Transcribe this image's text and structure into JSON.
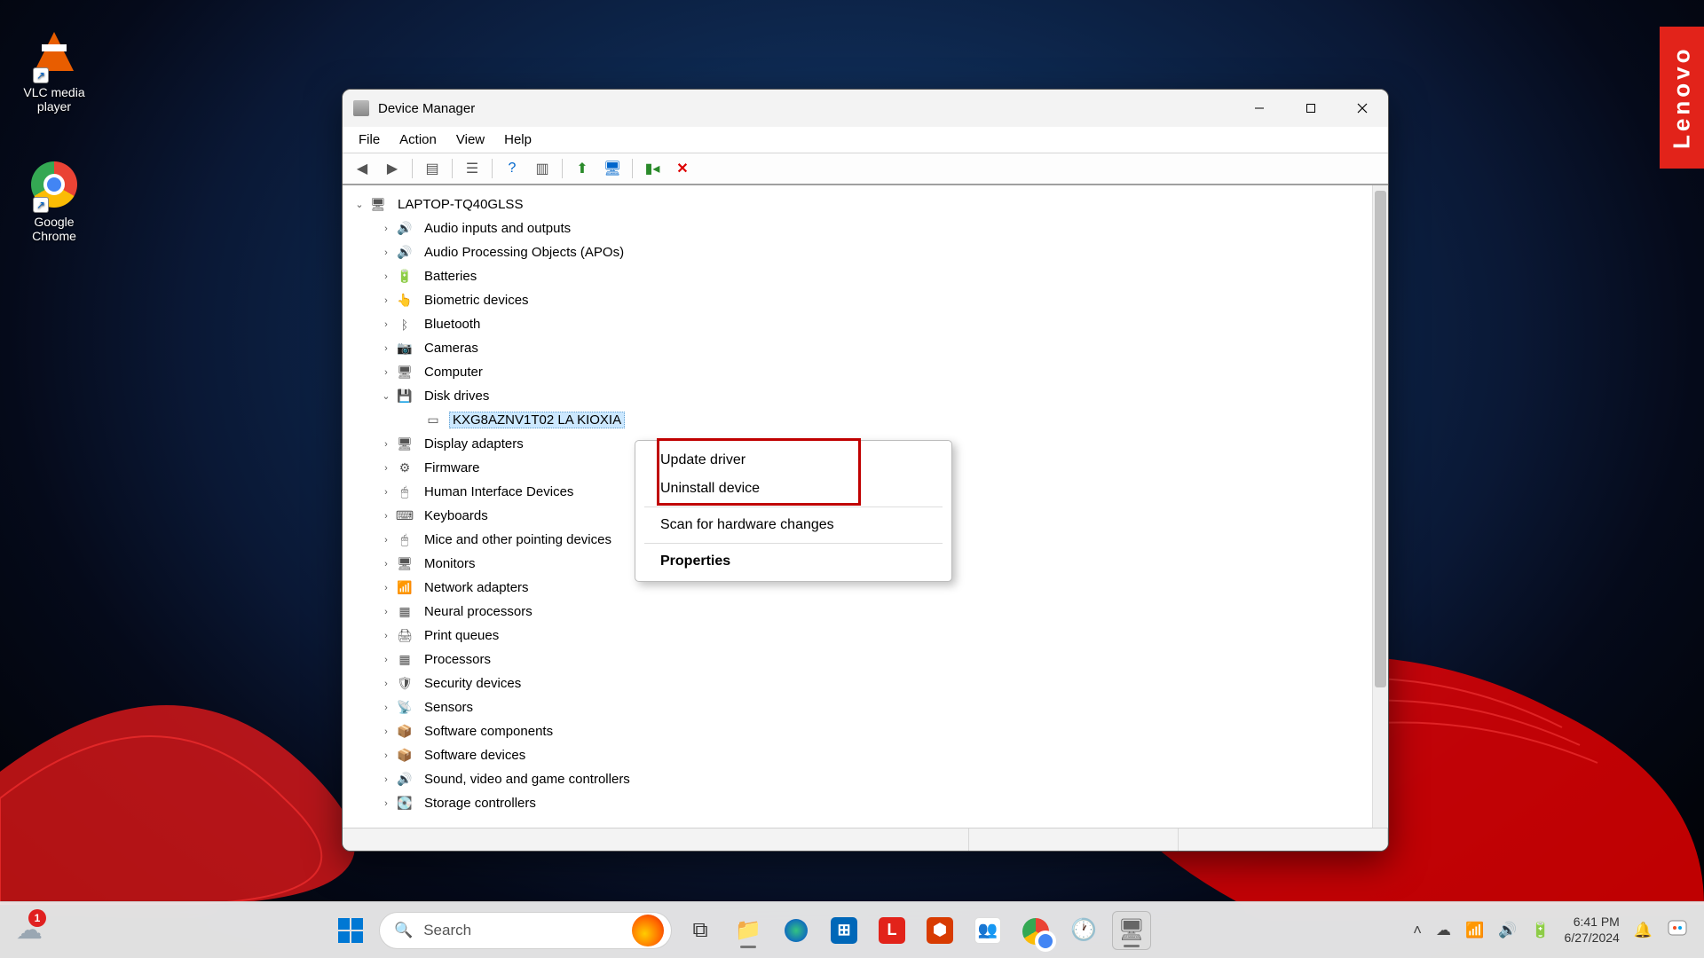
{
  "desktopIcons": {
    "vlc": "VLC media player",
    "chrome": "Google Chrome"
  },
  "lenovoTag": "Lenovo",
  "window": {
    "title": "Device Manager",
    "menus": [
      "File",
      "Action",
      "View",
      "Help"
    ],
    "rootNode": "LAPTOP-TQ40GLSS",
    "categories": [
      {
        "label": "Audio inputs and outputs",
        "icon": "🔊",
        "expanded": false
      },
      {
        "label": "Audio Processing Objects (APOs)",
        "icon": "🔊",
        "expanded": false
      },
      {
        "label": "Batteries",
        "icon": "🔋",
        "expanded": false
      },
      {
        "label": "Biometric devices",
        "icon": "👆",
        "expanded": false
      },
      {
        "label": "Bluetooth",
        "icon": "ᛒ",
        "expanded": false
      },
      {
        "label": "Cameras",
        "icon": "📷",
        "expanded": false
      },
      {
        "label": "Computer",
        "icon": "🖥",
        "expanded": false
      },
      {
        "label": "Disk drives",
        "icon": "💾",
        "expanded": true,
        "children": [
          {
            "label": "KXG8AZNV1T02 LA KIOXIA",
            "icon": "▭",
            "selected": true
          }
        ]
      },
      {
        "label": "Display adapters",
        "icon": "🖥",
        "expanded": false
      },
      {
        "label": "Firmware",
        "icon": "⚙",
        "expanded": false
      },
      {
        "label": "Human Interface Devices",
        "icon": "🖱",
        "expanded": false
      },
      {
        "label": "Keyboards",
        "icon": "⌨",
        "expanded": false
      },
      {
        "label": "Mice and other pointing devices",
        "icon": "🖱",
        "expanded": false
      },
      {
        "label": "Monitors",
        "icon": "🖥",
        "expanded": false
      },
      {
        "label": "Network adapters",
        "icon": "📶",
        "expanded": false
      },
      {
        "label": "Neural processors",
        "icon": "▦",
        "expanded": false
      },
      {
        "label": "Print queues",
        "icon": "🖨",
        "expanded": false
      },
      {
        "label": "Processors",
        "icon": "▦",
        "expanded": false
      },
      {
        "label": "Security devices",
        "icon": "🛡",
        "expanded": false
      },
      {
        "label": "Sensors",
        "icon": "📡",
        "expanded": false
      },
      {
        "label": "Software components",
        "icon": "📦",
        "expanded": false
      },
      {
        "label": "Software devices",
        "icon": "📦",
        "expanded": false
      },
      {
        "label": "Sound, video and game controllers",
        "icon": "🔊",
        "expanded": false
      },
      {
        "label": "Storage controllers",
        "icon": "💽",
        "expanded": false
      }
    ]
  },
  "contextMenu": {
    "items": [
      {
        "label": "Update driver",
        "bold": false
      },
      {
        "label": "Uninstall device",
        "bold": false
      },
      {
        "sep": true
      },
      {
        "label": "Scan for hardware changes",
        "bold": false
      },
      {
        "sep": true
      },
      {
        "label": "Properties",
        "bold": true
      }
    ]
  },
  "taskbar": {
    "weatherBadge": "1",
    "searchPlaceholder": "Search",
    "time": "6:41 PM",
    "date": "6/27/2024"
  }
}
